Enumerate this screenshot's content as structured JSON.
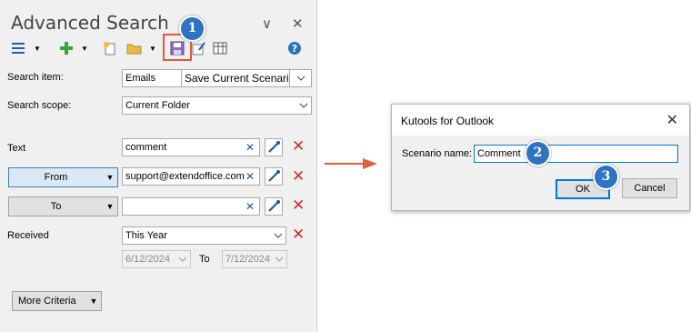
{
  "panel": {
    "title": "Advanced Search",
    "title_controls": {
      "collapse": "∨",
      "close": "✕"
    },
    "toolbar": {
      "icons": [
        "list-icon",
        "dropdown-arrow-icon",
        "add-icon",
        "dropdown-arrow-icon",
        "new-scenario-icon",
        "open-folder-icon",
        "dropdown-arrow-icon",
        "save-icon",
        "edit-icon",
        "grid-icon",
        "help-icon"
      ]
    },
    "search_item": {
      "label": "Search item:",
      "value": "Emails",
      "scenario_text": "Save Current Scenario"
    },
    "search_scope": {
      "label": "Search scope:",
      "value": "Current Folder"
    },
    "criteria": [
      {
        "label": "Text",
        "value": "comment"
      },
      {
        "label": "From",
        "value": "support@extendoffice.com"
      },
      {
        "label": "To",
        "value": ""
      }
    ],
    "received": {
      "label": "Received",
      "value": "This Year",
      "date_from": "6/12/2024",
      "to_label": "To",
      "date_to": "7/12/2024"
    },
    "more_criteria": "More Criteria"
  },
  "dialog": {
    "title": "Kutools for Outlook",
    "close": "✕",
    "scenario_label": "Scenario name:",
    "scenario_value": "Comment",
    "ok": "OK",
    "cancel": "Cancel"
  },
  "badges": [
    "1",
    "2",
    "3"
  ],
  "colors": {
    "badge": "#2e74c2",
    "highlight": "#e05a3a",
    "red_x": "#d22b2b",
    "arrow": "#e0603a"
  }
}
